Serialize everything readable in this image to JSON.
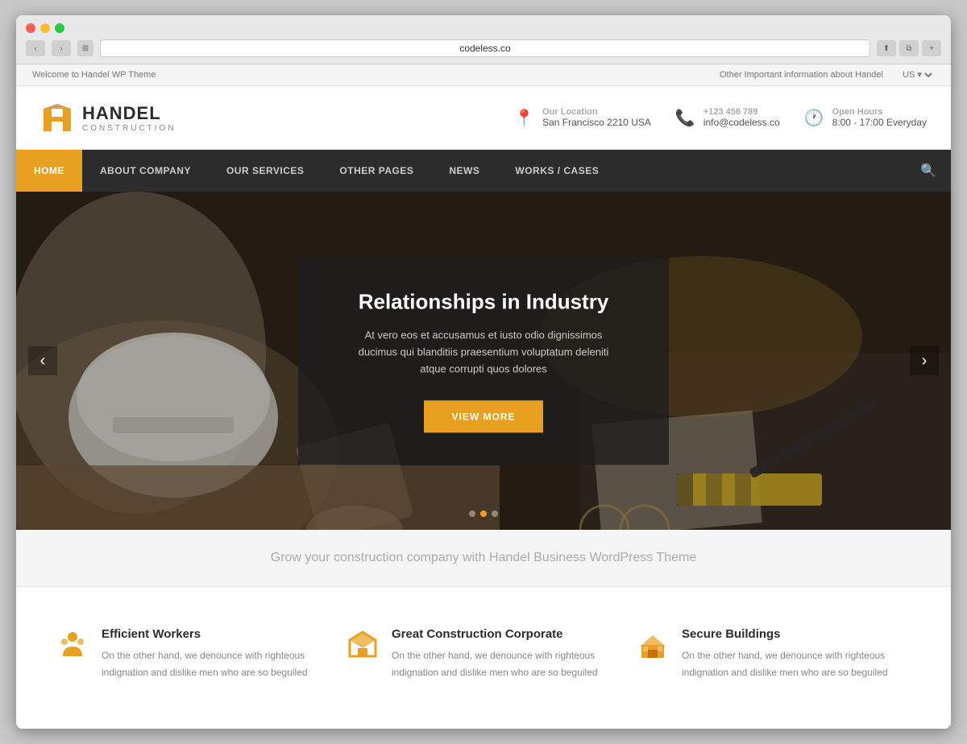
{
  "browser": {
    "url": "codeless.co"
  },
  "topbar": {
    "left": "Welcome to Handel WP Theme",
    "right": "Other Important information about Handel",
    "lang": "US"
  },
  "header": {
    "logo_name": "HANDEL",
    "logo_sub": "CONSTRUCTION",
    "location_label": "Our Location",
    "location_value": "San Francisco 2210 USA",
    "phone_label": "+123 456 789",
    "phone_value": "info@codeless.co",
    "hours_label": "Open Hours",
    "hours_value": "8:00 - 17:00 Everyday"
  },
  "nav": {
    "items": [
      {
        "label": "HOME",
        "active": true
      },
      {
        "label": "ABOUT COMPANY",
        "active": false
      },
      {
        "label": "OUR SERVICES",
        "active": false
      },
      {
        "label": "OTHER PAGES",
        "active": false
      },
      {
        "label": "NEWS",
        "active": false
      },
      {
        "label": "WORKS / CASES",
        "active": false
      }
    ]
  },
  "hero": {
    "title": "Relationships in Industry",
    "subtitle": "At vero eos et accusamus et iusto odio dignissimos ducimus qui blanditiis praesentium voluptatum deleniti atque corrupti quos dolores",
    "btn_label": "VIEW MORE",
    "dots": [
      1,
      2,
      3
    ],
    "active_dot": 2
  },
  "tagline": {
    "text": "Grow your construction company with Handel Business WordPress Theme"
  },
  "features": [
    {
      "icon": "👷",
      "title": "Efficient Workers",
      "desc": "On the other hand, we denounce with righteous indignation and dislike men who are so beguiled"
    },
    {
      "icon": "🔧",
      "title": "Great  Construction Corporate",
      "desc": "On the other hand, we denounce with righteous indignation and dislike men who are so beguiled"
    },
    {
      "icon": "🏗️",
      "title": "Secure Buildings",
      "desc": "On the other hand, we denounce with righteous indignation and dislike men who are so beguiled"
    }
  ]
}
